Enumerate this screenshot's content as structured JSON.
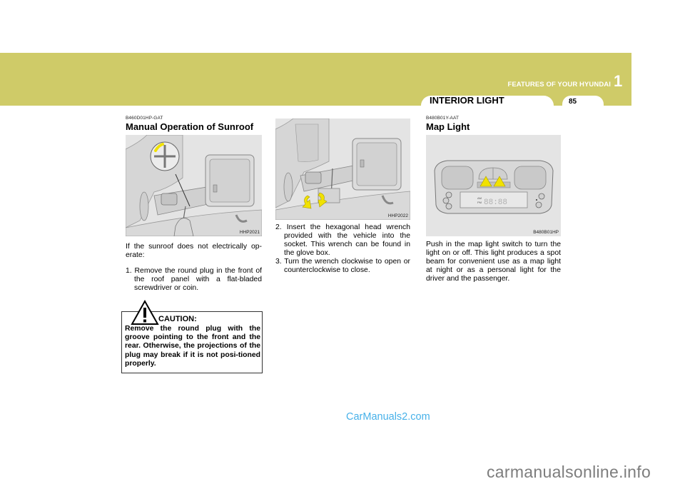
{
  "header": {
    "chapter_title": "FEATURES OF YOUR HYUNDAI",
    "chapter_number": "1",
    "section_title": "INTERIOR LIGHT",
    "page_number": "85",
    "band_color": "#cfcb68"
  },
  "left_column": {
    "code": "B460D01HP-GAT",
    "heading": "Manual Operation of Sunroof",
    "figure_label": "HHP2021",
    "intro": "If the sunroof does not electrically op-erate:",
    "steps": [
      "1. Remove the round plug in the front of the roof panel with a flat-bladed screwdriver or coin."
    ],
    "caution": {
      "title": "CAUTION:",
      "text": "Remove the round plug with the groove pointing to the front and the rear. Otherwise, the projections of the plug may break if it is not posi-tioned properly."
    }
  },
  "middle_column": {
    "figure_label": "HHP2022",
    "steps": [
      "2. Insert the hexagonal head wrench provided with the vehicle into the socket. This wrench can be found in the glove box.",
      "3. Turn the wrench clockwise to open or counterclockwise to close."
    ]
  },
  "right_column": {
    "code": "B480B01Y-AAT",
    "heading": "Map Light",
    "figure_label": "B480B01HP",
    "clock_am": "AM",
    "clock_pm": "PM",
    "body": "Push in the map light switch to turn the light on or off. This light produces a spot beam for convenient use as a map light at night or as a personal light for the driver and the passenger."
  },
  "watermarks": {
    "top": "CarManuals2.com",
    "bottom": "carmanualsonline.info"
  }
}
